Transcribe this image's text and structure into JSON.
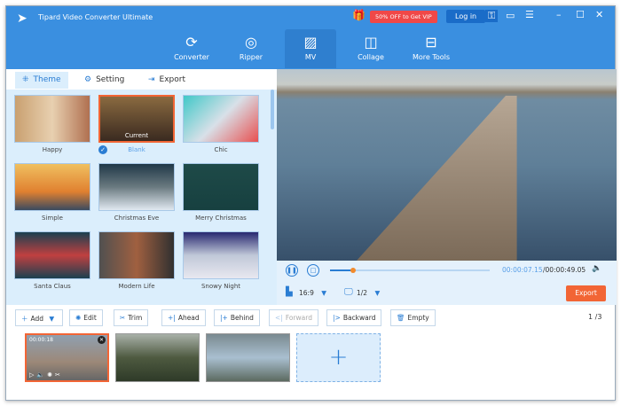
{
  "app": {
    "title": "Tipard Video Converter Ultimate",
    "promo": "50% OFF to Get VIP",
    "login": "Log in"
  },
  "nav": [
    {
      "label": "Converter",
      "icon": "converter-icon"
    },
    {
      "label": "Ripper",
      "icon": "disc-icon"
    },
    {
      "label": "MV",
      "icon": "mv-icon",
      "active": true
    },
    {
      "label": "Collage",
      "icon": "collage-icon"
    },
    {
      "label": "More Tools",
      "icon": "toolbox-icon"
    }
  ],
  "tabs": [
    {
      "label": "Theme",
      "active": true
    },
    {
      "label": "Setting"
    },
    {
      "label": "Export"
    }
  ],
  "themes": [
    {
      "label": "Happy"
    },
    {
      "label": "Blank",
      "current": true,
      "badge": "Current"
    },
    {
      "label": "Chic"
    },
    {
      "label": "Simple"
    },
    {
      "label": "Christmas Eve"
    },
    {
      "label": "Merry Christmas"
    },
    {
      "label": "Santa Claus"
    },
    {
      "label": "Modern Life"
    },
    {
      "label": "Snowy Night"
    }
  ],
  "player": {
    "current_time": "00:00:07.15",
    "total_time": "/00:00:49.05",
    "progress": 0.146,
    "aspect": "16:9",
    "screen": "1/2",
    "export": "Export"
  },
  "toolbar": {
    "add": "Add",
    "edit": "Edit",
    "trim": "Trim",
    "ahead": "Ahead",
    "behind": "Behind",
    "forward": "Forward",
    "backward": "Backward",
    "empty": "Empty",
    "page": "1",
    "total": "3"
  },
  "clips": [
    {
      "duration": "00:00:18",
      "selected": true
    },
    {},
    {}
  ],
  "colors": {
    "accent": "#3a8fe0",
    "export": "#f26535",
    "vip": "#f04848"
  }
}
